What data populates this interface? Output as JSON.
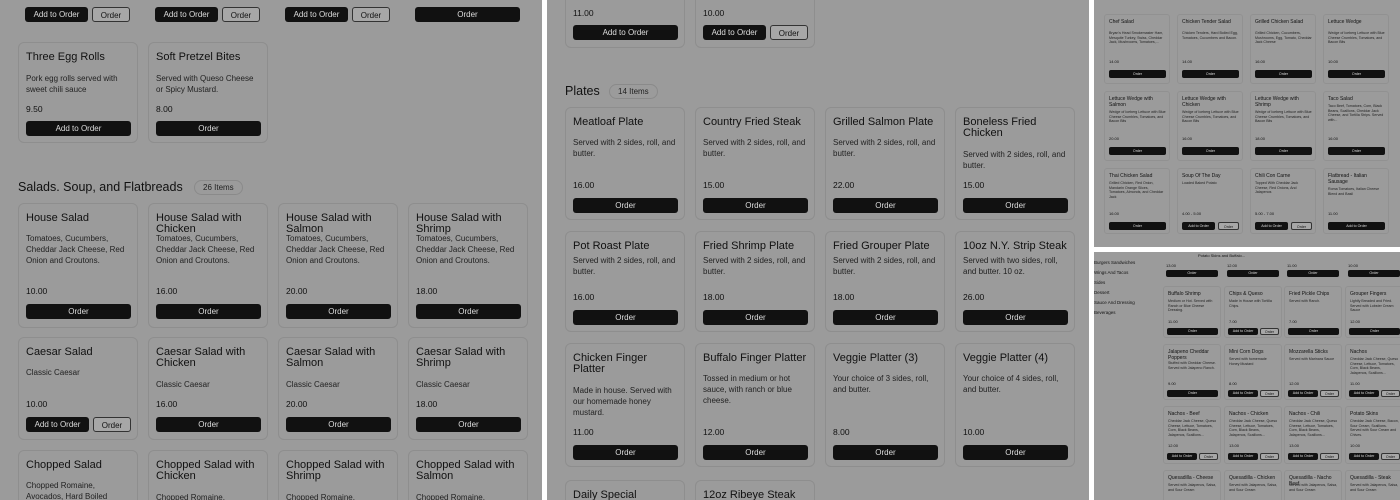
{
  "panelA": {
    "top_buttons": {
      "add": "Add to Order",
      "order": "Order"
    },
    "appetizers": [
      {
        "title": "Three Egg Rolls",
        "desc": "Pork egg rolls served with sweet chili sauce",
        "price": "9.50",
        "add": "Add to Order"
      },
      {
        "title": "Soft Pretzel Bites",
        "desc": "Served with Queso Cheese or Spicy Mustard.",
        "price": "8.00",
        "order": "Order"
      }
    ],
    "section": {
      "title": "Salads. Soup, and Flatbreads",
      "count": "26 Items"
    },
    "rows": [
      [
        {
          "title": "House Salad",
          "desc": "Tomatoes, Cucumbers, Cheddar Jack Cheese, Red Onion and Croutons.",
          "price": "10.00",
          "order": "Order"
        },
        {
          "title": "House Salad with Chicken",
          "desc": "Tomatoes, Cucumbers, Cheddar Jack Cheese, Red Onion and Croutons.",
          "price": "16.00",
          "order": "Order"
        },
        {
          "title": "House Salad with Salmon",
          "desc": "Tomatoes, Cucumbers, Cheddar Jack Cheese, Red Onion and Croutons.",
          "price": "20.00",
          "order": "Order"
        },
        {
          "title": "House Salad with Shrimp",
          "desc": "Tomatoes, Cucumbers, Cheddar Jack Cheese, Red Onion and Croutons.",
          "price": "18.00",
          "order": "Order"
        }
      ],
      [
        {
          "title": "Caesar Salad",
          "desc": "Classic Caesar",
          "price": "10.00",
          "add": "Add to Order",
          "order": "Order"
        },
        {
          "title": "Caesar Salad with Chicken",
          "desc": "Classic Caesar",
          "price": "16.00",
          "order": "Order"
        },
        {
          "title": "Caesar Salad with Salmon",
          "desc": "Classic Caesar",
          "price": "20.00",
          "order": "Order"
        },
        {
          "title": "Caesar Salad with Shrimp",
          "desc": "Classic Caesar",
          "price": "18.00",
          "order": "Order"
        }
      ],
      [
        {
          "title": "Chopped Salad",
          "desc": "Chopped Romaine, Avocados, Hard Boiled"
        },
        {
          "title": "Chopped Salad with Chicken",
          "desc": "Chopped Romaine,"
        },
        {
          "title": "Chopped Salad with Shrimp",
          "desc": "Chopped Romaine,"
        },
        {
          "title": "Chopped Salad with Salmon",
          "desc": "Chopped Romaine,"
        }
      ]
    ]
  },
  "panelB": {
    "top": [
      {
        "price": "11.00",
        "add": "Add to Order"
      },
      {
        "price": "10.00",
        "add": "Add to Order",
        "order": "Order"
      }
    ],
    "section": {
      "title": "Plates",
      "count": "14 Items"
    },
    "rows": [
      [
        {
          "title": "Meatloaf Plate",
          "desc": "Served with 2 sides, roll, and butter.",
          "price": "16.00",
          "order": "Order"
        },
        {
          "title": "Country Fried Steak",
          "desc": "Served with 2 sides, roll, and butter.",
          "price": "15.00",
          "order": "Order"
        },
        {
          "title": "Grilled Salmon Plate",
          "desc": "Served with 2 sides, roll, and butter.",
          "price": "22.00",
          "order": "Order"
        },
        {
          "title": "Boneless Fried Chicken",
          "desc": "Served with 2 sides, roll, and butter.",
          "price": "15.00",
          "order": "Order"
        }
      ],
      [
        {
          "title": "Pot Roast Plate",
          "desc": "Served with 2 sides, roll, and butter.",
          "price": "16.00",
          "order": "Order"
        },
        {
          "title": "Fried Shrimp Plate",
          "desc": "Served with 2 sides, roll, and butter.",
          "price": "18.00",
          "order": "Order"
        },
        {
          "title": "Fried Grouper Plate",
          "desc": "Served with 2 sides, roll, and butter.",
          "price": "18.00",
          "order": "Order"
        },
        {
          "title": "10oz N.Y. Strip Steak",
          "desc": "Served with two sides, roll, and butter. 10 oz.",
          "price": "26.00",
          "order": "Order"
        }
      ],
      [
        {
          "title": "Chicken Finger Platter",
          "desc": "Made in house. Served with our homemade honey mustard.",
          "price": "11.00",
          "order": "Order"
        },
        {
          "title": "Buffalo Finger Platter",
          "desc": "Tossed in medium or hot sauce, with ranch or blue cheese.",
          "price": "12.00",
          "order": "Order"
        },
        {
          "title": "Veggie Platter (3)",
          "desc": "Your choice of 3 sides, roll, and butter.",
          "price": "8.00",
          "order": "Order"
        },
        {
          "title": "Veggie Platter (4)",
          "desc": "Your choice of 4 sides, roll, and butter.",
          "price": "10.00",
          "order": "Order"
        }
      ],
      [
        {
          "title": "Daily Special"
        },
        {
          "title": "12oz Ribeye Steak"
        }
      ]
    ]
  },
  "panelC": {
    "rows": [
      [
        {
          "title": "Chef Salad",
          "desc": "Bryan's Head Smokemaster Ham, Mesquite Turkey, Swiss, Cheddar Jack, Mushrooms, Tomatoes,...",
          "price": "14.00",
          "order": "Order"
        },
        {
          "title": "Chicken Tender Salad",
          "desc": "Chicken Tenders, Hard Boiled Egg, Tomatoes, Cucumbers and Bacon.",
          "price": "14.00",
          "order": "Order"
        },
        {
          "title": "Grilled Chicken Salad",
          "desc": "Grilled Chicken, Cucumbers, Mushrooms, Egg, Tomato, Cheddar Jack Cheese",
          "price": "16.00",
          "order": "Order"
        },
        {
          "title": "Lettuce Wedge",
          "desc": "Wedge of Iceberg Lettuce with Blue Cheese Crumbles, Tomatoes, and Bacon Bits",
          "price": "10.00",
          "order": "Order"
        }
      ],
      [
        {
          "title": "Lettuce Wedge with Salmon",
          "desc": "Wedge of Iceberg Lettuce with Blue Cheese Crumbles, Tomatoes, and Bacon Bits",
          "price": "20.00",
          "order": "Order"
        },
        {
          "title": "Lettuce Wedge with Chicken",
          "desc": "Wedge of Iceberg Lettuce with Blue Cheese Crumbles, Tomatoes, and Bacon Bits",
          "price": "16.00",
          "order": "Order"
        },
        {
          "title": "Lettuce Wedge with Shrimp",
          "desc": "Wedge of Iceberg Lettuce with Blue Cheese Crumbles, Tomatoes, and Bacon Bits",
          "price": "18.00",
          "order": "Order"
        },
        {
          "title": "Taco Salad",
          "desc": "Taco Beef, Tomatoes, Corn, Black Beans, Scallions, Cheddar Jack Cheese, and Tortilla Strips. Served with...",
          "price": "16.00",
          "order": "Order"
        }
      ],
      [
        {
          "title": "Thai Chicken Salad",
          "desc": "Grilled Chicken, Red Onion, Mandarin Orange Slices, Tomatoes, Almonds, and Cheddar Jack",
          "price": "16.00",
          "order": "Order"
        },
        {
          "title": "Soup Of The Day",
          "desc": "Loaded Baked Potato",
          "price": "4.00 - 5.00",
          "add": "Add to Order",
          "order": "Order"
        },
        {
          "title": "Chili Con Carne",
          "desc": "Topped With Cheddar Jack Cheese, Red Onions, And Jalapenos",
          "price": "5.00 - 7.00",
          "add": "Add to Order",
          "order": "Order"
        },
        {
          "title": "Flatbread - Italian Sausage",
          "desc": "Roma Tomatoes, Italian Cheese Blend and Basil",
          "price": "11.00",
          "add": "Add to Order"
        }
      ]
    ]
  },
  "panelD": {
    "nav": [
      "Burgers Sandwiches",
      "Wings And Tacos",
      "Sides",
      "Dessert",
      "Sauce And Dressing",
      "Beverages"
    ],
    "top_fragment": "Potato Skins and Buffalo...",
    "top_prices": [
      "13.00",
      "12.00",
      "11.00",
      "10.00"
    ],
    "top_buttons": [
      "Order",
      "Order",
      "Order",
      "Order"
    ],
    "rows": [
      [
        {
          "title": "Buffalo Shrimp",
          "desc": "Medium or Hot. Served with Ranch or Blue Cheese Dressing.",
          "price": "11.00",
          "order": "Order"
        },
        {
          "title": "Chips & Queso",
          "desc": "Made in House with Tortilla Chips.",
          "price": "7.00",
          "add": "Add to Order",
          "order": "Order"
        },
        {
          "title": "Fried Pickle Chips",
          "desc": "Served with Ranch.",
          "price": "7.00",
          "order": "Order"
        },
        {
          "title": "Grouper Fingers",
          "desc": "Lightly Breaded and Fried. Served with Lobster Cream Sauce",
          "price": "12.00",
          "order": "Order"
        }
      ],
      [
        {
          "title": "Jalapeno Cheddar Poppers",
          "desc": "Stuffed with Cheddar Cheese. Served with Jalapeno Ranch.",
          "price": "9.00",
          "order": "Order"
        },
        {
          "title": "Mini Corn Dogs",
          "desc": "Served with homemade Honey Mustard",
          "price": "8.00",
          "add": "Add to Order",
          "order": "Order"
        },
        {
          "title": "Mozzarella Sticks",
          "desc": "Served with Marinara Sauce",
          "price": "12.00",
          "add": "Add to Order",
          "order": "Order"
        },
        {
          "title": "Nachos",
          "desc": "Cheddar Jack Cheese, Queso Cheese, Lettuce, Tomatoes, Corn, Black Beans, Jalapenos, Scallions...",
          "price": "11.00",
          "add": "Add to Order",
          "order": "Order"
        }
      ],
      [
        {
          "title": "Nachos - Beef",
          "desc": "Cheddar Jack Cheese, Queso Cheese, Lettuce, Tomatoes, Corn, Black Beans, Jalapenos, Scallions...",
          "price": "12.00",
          "add": "Add to Order",
          "order": "Order"
        },
        {
          "title": "Nachos - Chicken",
          "desc": "Cheddar Jack Cheese, Queso Cheese, Lettuce, Tomatoes, Corn, Black Beans, Jalapenos, Scallions...",
          "price": "13.00",
          "add": "Add to Order",
          "order": "Order"
        },
        {
          "title": "Nachos - Chili",
          "desc": "Cheddar Jack Cheese, Queso Cheese, Lettuce, Tomatoes, Corn, Black Beans, Jalapenos, Scallions...",
          "price": "13.00",
          "add": "Add to Order",
          "order": "Order"
        },
        {
          "title": "Potato Skins",
          "desc": "Cheddar Jack Cheese, Bacon, Sour Cream, Scallions. Served with Sour Cream and Chives.",
          "price": "10.00",
          "add": "Add to Order",
          "order": "Order"
        }
      ],
      [
        {
          "title": "Quesadilla - Cheese",
          "desc": "Served with Jalapenos, Salsa, and Sour Cream"
        },
        {
          "title": "Quesadilla - Chicken",
          "desc": "Served with Jalapenos, Salsa, and Sour Cream"
        },
        {
          "title": "Quesadilla - Nacho Beef",
          "desc": "Served with Jalapenos, Salsa, and Sour Cream"
        },
        {
          "title": "Quesadilla - Steak",
          "desc": "Served with Jalapenos, Salsa, and Sour Cream"
        }
      ]
    ]
  }
}
